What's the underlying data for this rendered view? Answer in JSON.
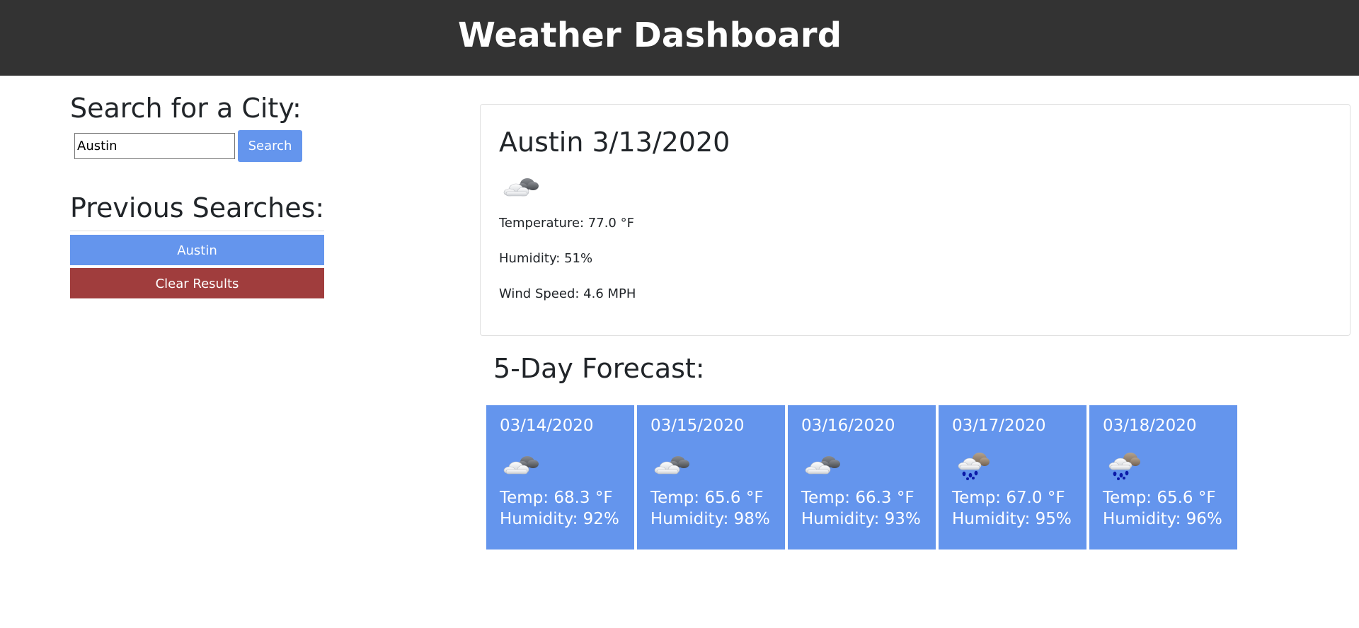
{
  "header": {
    "title": "Weather Dashboard"
  },
  "search": {
    "heading": "Search for a City:",
    "input_value": "Austin",
    "button_label": "Search"
  },
  "previous": {
    "heading": "Previous Searches:",
    "items": [
      {
        "label": "Austin"
      }
    ],
    "clear_label": "Clear Results"
  },
  "current": {
    "title": "Austin 3/13/2020",
    "icon": "broken-clouds-icon",
    "temperature": "Temperature: 77.0 °F",
    "humidity": "Humidity: 51%",
    "wind": "Wind Speed: 4.6 MPH"
  },
  "forecast": {
    "heading": "5-Day Forecast:",
    "days": [
      {
        "date": "03/14/2020",
        "icon": "broken-clouds-icon",
        "temp": "Temp: 68.3 °F",
        "humidity": "Humidity: 92%"
      },
      {
        "date": "03/15/2020",
        "icon": "broken-clouds-icon",
        "temp": "Temp: 65.6 °F",
        "humidity": "Humidity: 98%"
      },
      {
        "date": "03/16/2020",
        "icon": "broken-clouds-icon",
        "temp": "Temp: 66.3 °F",
        "humidity": "Humidity: 93%"
      },
      {
        "date": "03/17/2020",
        "icon": "rain-icon",
        "temp": "Temp: 67.0 °F",
        "humidity": "Humidity: 95%"
      },
      {
        "date": "03/18/2020",
        "icon": "rain-icon",
        "temp": "Temp: 65.6 °F",
        "humidity": "Humidity: 96%"
      }
    ]
  },
  "colors": {
    "header_bg": "#333333",
    "accent": "#6495ed",
    "danger": "#a03d3d"
  }
}
